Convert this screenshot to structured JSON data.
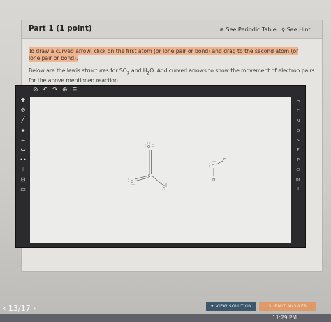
{
  "header": {
    "part_title": "Part 1   (1 point)",
    "periodic_table": "See Periodic Table",
    "hint": "See Hint"
  },
  "instruction": "To draw a curved arrow, click on the first atom (or lone pair or bond) and drag to the second atom (or lone pair or bond).",
  "question": {
    "part1": "Below are the lewis structures for SO",
    "sub1": "3",
    "part2": " and H",
    "sub2": "2",
    "part3": "O. Add curved arrows to show the movement of electron pairs for the above mentioned reaction."
  },
  "sketcher": {
    "element_list": [
      "H",
      "C",
      "N",
      "O",
      "S",
      "F",
      "P",
      "Cl",
      "Br",
      "I"
    ],
    "molecule_labels": {
      "so3_o_top": "O",
      "so3_o_left": "O",
      "so3_s": "S",
      "so3_o_right": "O",
      "h2o_o": "O",
      "h2o_h_top": "H",
      "h2o_h_bottom": "H"
    }
  },
  "footer": {
    "view_solution": "VIEW SOLUTION",
    "submit": "SUBMIT ANSWER",
    "page": "13/17"
  },
  "taskbar": {
    "time": "11:29 PM"
  },
  "colors": {
    "instruction_highlight": "#f0b48e",
    "view_solution_bg": "#3c566b",
    "submit_bg": "#e09968",
    "sketcher_frame": "#2b2b2d"
  }
}
